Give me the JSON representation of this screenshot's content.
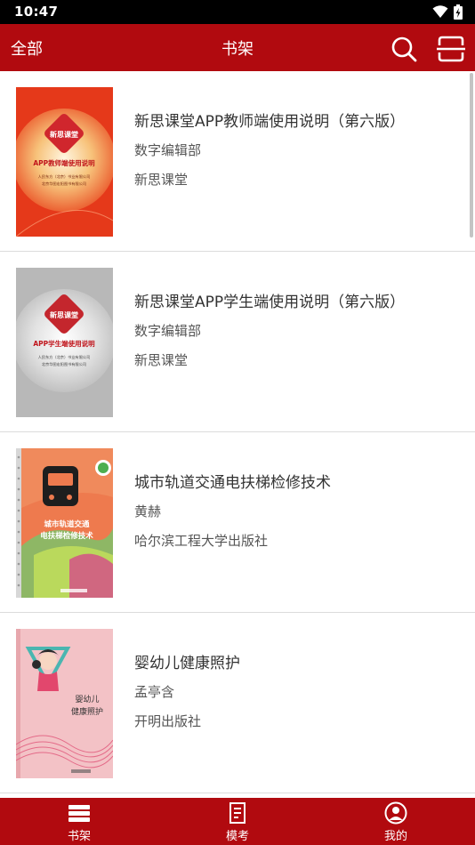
{
  "status_bar": {
    "time": "10:47",
    "icons": [
      "wifi-icon",
      "battery-icon"
    ]
  },
  "app_bar": {
    "left_label": "全部",
    "title": "书架",
    "search_icon": "search-icon",
    "scan_icon": "scan-icon"
  },
  "colors": {
    "primary": "#b10a0f",
    "text": "#333333",
    "subtext": "#555555"
  },
  "books": [
    {
      "title": "新思课堂APP教师端使用说明（第六版）",
      "author": "数字编辑部",
      "publisher": "新思课堂",
      "cover": {
        "badge": "新思课堂",
        "caption": "APP教师端使用说明",
        "line1": "人民东方（北京）书业有限公司",
        "line2": "北京华图宏阳图书有限公司"
      }
    },
    {
      "title": "新思课堂APP学生端使用说明（第六版）",
      "author": "数字编辑部",
      "publisher": "新思课堂",
      "cover": {
        "badge": "新思课堂",
        "caption": "APP学生端使用说明",
        "line1": "人民东方（北京）书业有限公司",
        "line2": "北京华图宏阳图书有限公司"
      }
    },
    {
      "title": "城市轨道交通电扶梯检修技术",
      "author": "黄赫",
      "publisher": "哈尔滨工程大学出版社",
      "cover": {
        "caption1": "城市轨道交通",
        "caption2": "电扶梯检修技术"
      }
    },
    {
      "title": "婴幼儿健康照护",
      "author": "孟亭含",
      "publisher": "开明出版社",
      "cover": {
        "caption1": "婴幼儿",
        "caption2": "健康照护"
      }
    }
  ],
  "tabs": [
    {
      "label": "书架",
      "icon": "bookshelf-icon"
    },
    {
      "label": "模考",
      "icon": "exam-icon"
    },
    {
      "label": "我的",
      "icon": "profile-icon"
    }
  ]
}
